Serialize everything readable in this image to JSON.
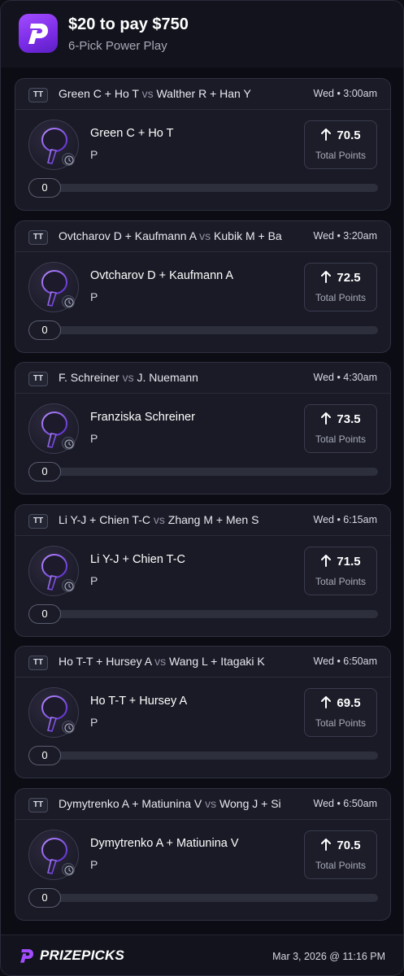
{
  "header": {
    "title": "$20 to pay $750",
    "subtitle": "6-Pick Power Play",
    "logo_icon": "prizepicks-logo-icon"
  },
  "colors": {
    "accent": "#7b3bea",
    "background": "#12131c",
    "card": "#191a25"
  },
  "picks": [
    {
      "sport": "TT",
      "home": "Green C + Ho T",
      "vs": "vs",
      "away": "Walther R + Han Y",
      "time": "Wed • 3:00am",
      "player": "Green C + Ho T",
      "position": "P",
      "line": "70.5",
      "direction": "up-arrow-icon",
      "stat": "Total Points",
      "progress": "0",
      "progress_fraction": 0
    },
    {
      "sport": "TT",
      "home": "Ovtcharov D + Kaufmann A",
      "vs": "vs",
      "away": "Kubik M + Ba",
      "time": "Wed • 3:20am",
      "player": "Ovtcharov D + Kaufmann A",
      "position": "P",
      "line": "72.5",
      "direction": "up-arrow-icon",
      "stat": "Total Points",
      "progress": "0",
      "progress_fraction": 0
    },
    {
      "sport": "TT",
      "home": "F. Schreiner",
      "vs": "vs",
      "away": "J. Nuemann",
      "time": "Wed • 4:30am",
      "player": "Franziska Schreiner",
      "position": "P",
      "line": "73.5",
      "direction": "up-arrow-icon",
      "stat": "Total Points",
      "progress": "0",
      "progress_fraction": 0
    },
    {
      "sport": "TT",
      "home": "Li Y-J + Chien T-C",
      "vs": "vs",
      "away": "Zhang M + Men S",
      "time": "Wed • 6:15am",
      "player": "Li Y-J + Chien T-C",
      "position": "P",
      "line": "71.5",
      "direction": "up-arrow-icon",
      "stat": "Total Points",
      "progress": "0",
      "progress_fraction": 0
    },
    {
      "sport": "TT",
      "home": "Ho T-T + Hursey A",
      "vs": "vs",
      "away": "Wang L + Itagaki K",
      "time": "Wed • 6:50am",
      "player": "Ho T-T + Hursey A",
      "position": "P",
      "line": "69.5",
      "direction": "up-arrow-icon",
      "stat": "Total Points",
      "progress": "0",
      "progress_fraction": 0
    },
    {
      "sport": "TT",
      "home": "Dymytrenko A + Matiunina V",
      "vs": "vs",
      "away": "Wong J + Si",
      "time": "Wed • 6:50am",
      "player": "Dymytrenko A + Matiunina V",
      "position": "P",
      "line": "70.5",
      "direction": "up-arrow-icon",
      "stat": "Total Points",
      "progress": "0",
      "progress_fraction": 0
    }
  ],
  "footer": {
    "brand": "PRIZEPICKS",
    "timestamp": "Mar 3, 2026 @ 11:16 PM"
  }
}
